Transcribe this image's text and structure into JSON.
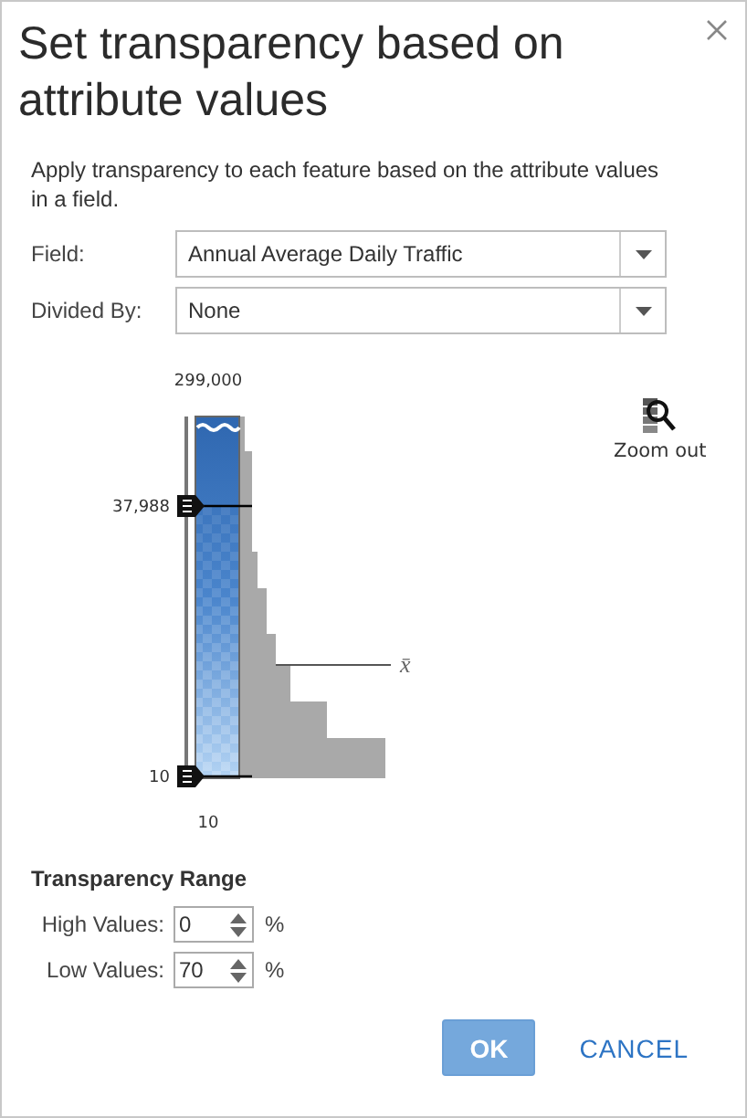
{
  "dialog": {
    "title": "Set transparency based on attribute values",
    "description": "Apply transparency to each feature based on the attribute values in a field."
  },
  "fields": [
    {
      "label": "Field:",
      "value": "Annual Average Daily Traffic"
    },
    {
      "label": "Divided By:",
      "value": "None"
    }
  ],
  "histogram": {
    "max_label": "299,000",
    "high_handle_label": "37,988",
    "low_handle_label": "10",
    "mean_label": "x̄",
    "min_label": "10"
  },
  "zoom_out": {
    "label": "Zoom out"
  },
  "range": {
    "title": "Transparency Range",
    "rows": [
      {
        "label": "High Values:",
        "value": "0",
        "unit": "%"
      },
      {
        "label": "Low Values:",
        "value": "70",
        "unit": "%"
      }
    ]
  },
  "buttons": [
    {
      "label": "OK",
      "kind": "primary"
    },
    {
      "label": "CANCEL",
      "kind": "link"
    }
  ]
}
